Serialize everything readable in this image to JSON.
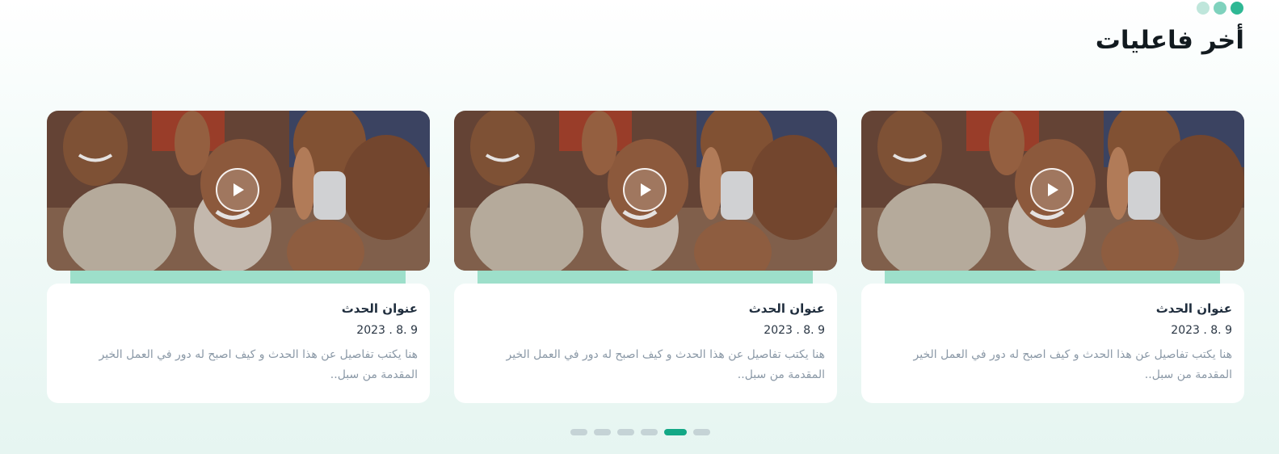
{
  "section": {
    "title": "أخر فاعليات"
  },
  "cards": [
    {
      "title": "عنوان الحدث",
      "date": "2023 . 8. 9",
      "description": "هنا يكتب تفاصيل عن هذا الحدث و كيف اصبح له دور في العمل الخير المقدمة من سبل..",
      "image": "children-smiling-photo",
      "play_icon": "play-icon"
    },
    {
      "title": "عنوان الحدث",
      "date": "2023 . 8. 9",
      "description": "هنا يكتب تفاصيل عن هذا الحدث و كيف اصبح له دور في العمل الخير المقدمة من سبل..",
      "image": "children-smiling-photo",
      "play_icon": "play-icon"
    },
    {
      "title": "عنوان الحدث",
      "date": "2023 . 8. 9",
      "description": "هنا يكتب تفاصيل عن هذا الحدث و كيف اصبح له دور في العمل الخير المقدمة من سبل..",
      "image": "children-smiling-photo",
      "play_icon": "play-icon"
    }
  ],
  "pagination": {
    "count": 6,
    "active_index": 4
  },
  "colors": {
    "accent": "#13a886",
    "accent_bar": "#9ddfca",
    "title_text": "#121a1f",
    "muted_text": "#8a98a6"
  }
}
